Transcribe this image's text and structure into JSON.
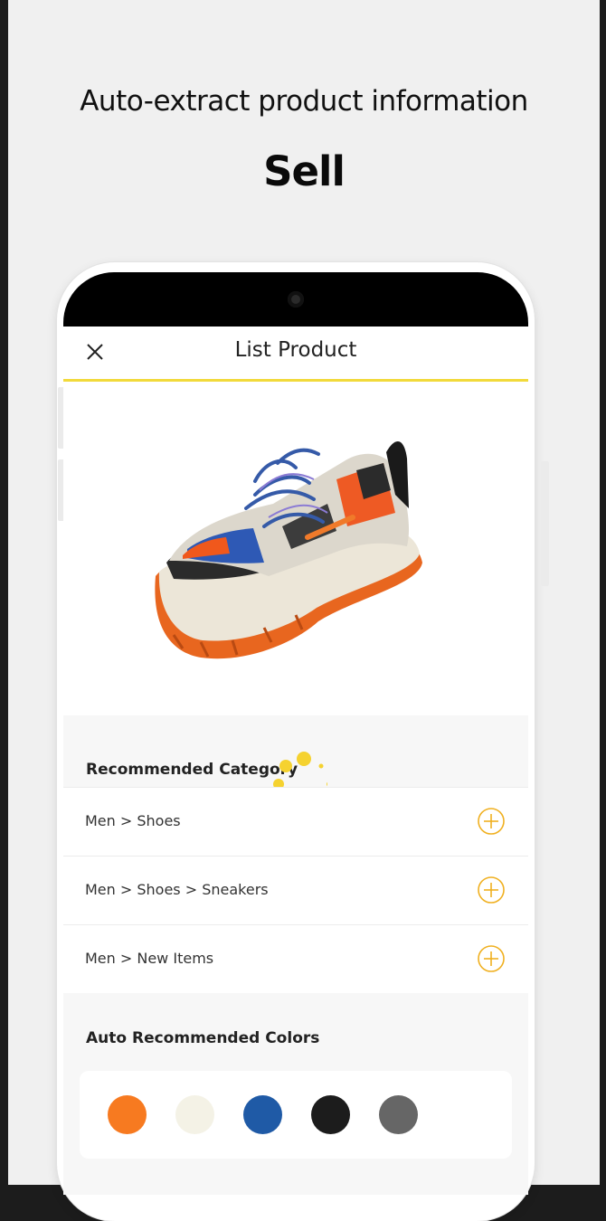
{
  "promo": {
    "headline": "Auto-extract product information",
    "subhead": "Sell"
  },
  "header": {
    "title": "List Product",
    "close_icon": "close-icon"
  },
  "recommended_category": {
    "title": "Recommended Category",
    "items": [
      {
        "label": "Men > Shoes",
        "icon": "add-circle-icon"
      },
      {
        "label": "Men > Shoes > Sneakers",
        "icon": "add-circle-icon"
      },
      {
        "label": "Men > New Items",
        "icon": "add-circle-icon"
      }
    ]
  },
  "recommended_colors": {
    "title": "Auto Recommended Colors",
    "swatches": [
      "#f77a20",
      "#f4f2e6",
      "#1f5aa6",
      "#1c1c1c",
      "#666666"
    ]
  },
  "theme": {
    "accent": "#f2da3b",
    "icon_accent": "#f0b020",
    "spinner": "#f5d230"
  }
}
